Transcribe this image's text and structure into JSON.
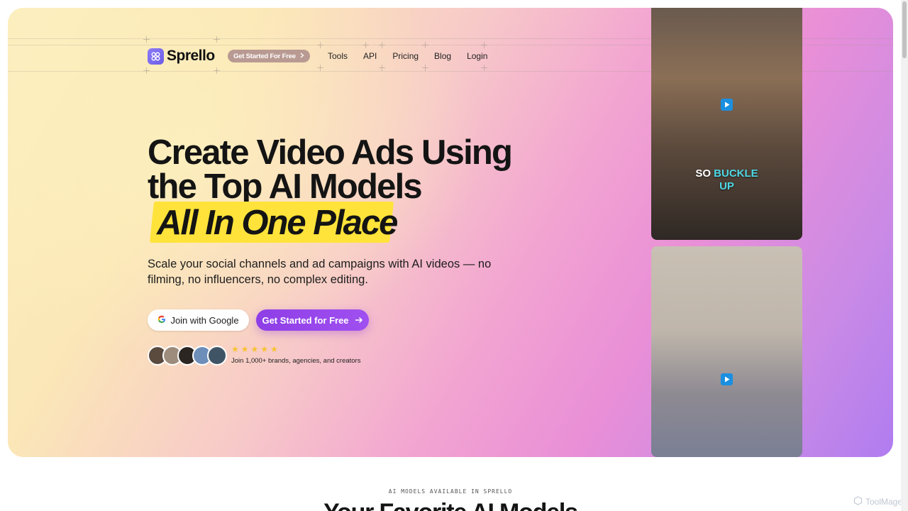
{
  "brand": {
    "name": "Sprello",
    "icon": "sprello-logo-icon"
  },
  "nav": {
    "cta_label": "Get Started For Free",
    "links": [
      "Tools",
      "API",
      "Pricing",
      "Blog",
      "Login"
    ]
  },
  "hero": {
    "headline_line1": "Create Video Ads Using",
    "headline_line2": "the Top AI Models",
    "highlight": "All In One Place",
    "subtext": "Scale your social channels and ad campaigns with AI videos — no filming, no influencers, no complex editing.",
    "google_button": "Join with Google",
    "primary_button": "Get Started for Free",
    "rating_stars": 5,
    "social_proof": "Join 1,000+ brands, agencies, and creators"
  },
  "videos": [
    {
      "caption_white": "SO",
      "caption_accent": "BUCKLE",
      "caption_line2": "UP"
    },
    {
      "caption_white": ""
    }
  ],
  "section": {
    "label": "AI MODELS AVAILABLE IN SPRELLO",
    "title": "Your Favorite AI Models"
  },
  "watermark": "ToolMage",
  "colors": {
    "primary": "#9347ea",
    "highlight": "#ffe33a",
    "play": "#1b8fe0",
    "star": "#f7c233"
  }
}
